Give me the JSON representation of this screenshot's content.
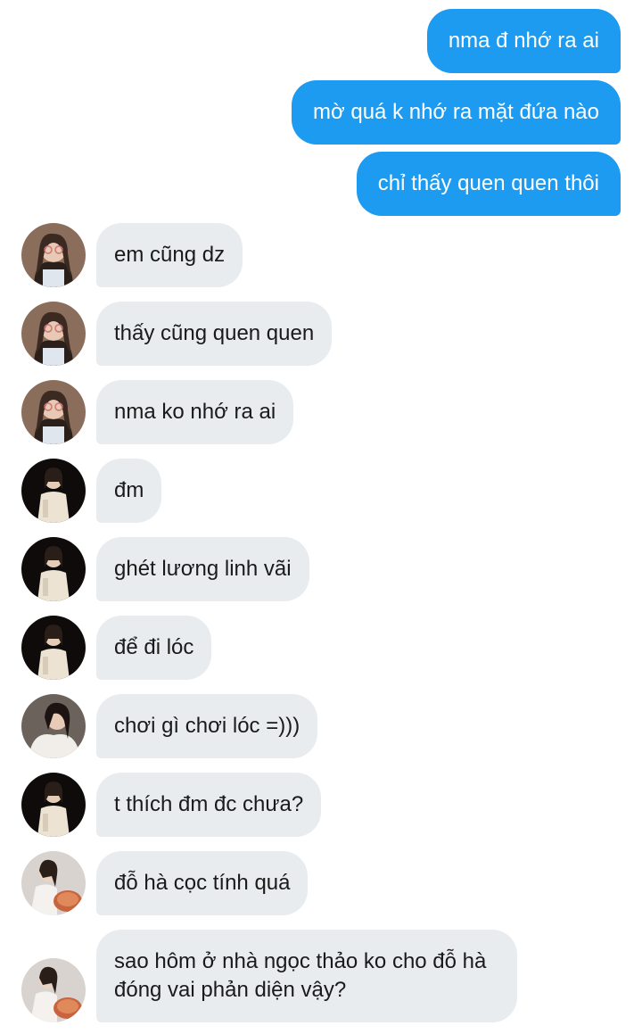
{
  "conversation": {
    "sent": [
      {
        "text": "nma đ nhớ ra ai"
      },
      {
        "text": "mờ quá k nhớ ra mặt đứa nào"
      },
      {
        "text": "chỉ thấy quen quen thôi"
      }
    ],
    "received": [
      {
        "text": "em cũng dz",
        "avatar": "avatar-a"
      },
      {
        "text": "thấy cũng quen quen",
        "avatar": "avatar-a"
      },
      {
        "text": "nma ko nhớ ra ai",
        "avatar": "avatar-a"
      },
      {
        "text": "đm",
        "avatar": "avatar-b"
      },
      {
        "text": "ghét lương linh vãi",
        "avatar": "avatar-b"
      },
      {
        "text": "để đi lóc",
        "avatar": "avatar-b"
      },
      {
        "text": "chơi gì chơi lóc =)))",
        "avatar": "avatar-c"
      },
      {
        "text": "t thích đm đc chưa?",
        "avatar": "avatar-b"
      },
      {
        "text": "đỗ hà cọc tính quá",
        "avatar": "avatar-d"
      },
      {
        "text": "sao hôm ở nhà ngọc thảo ko cho đỗ hà đóng vai phản diện vậy?",
        "avatar": "avatar-d"
      }
    ]
  },
  "colors": {
    "sent_bubble": "#1d9bf0",
    "received_bubble": "#e8ecef",
    "sent_text": "#ffffff",
    "received_text": "#1a1a1a"
  }
}
